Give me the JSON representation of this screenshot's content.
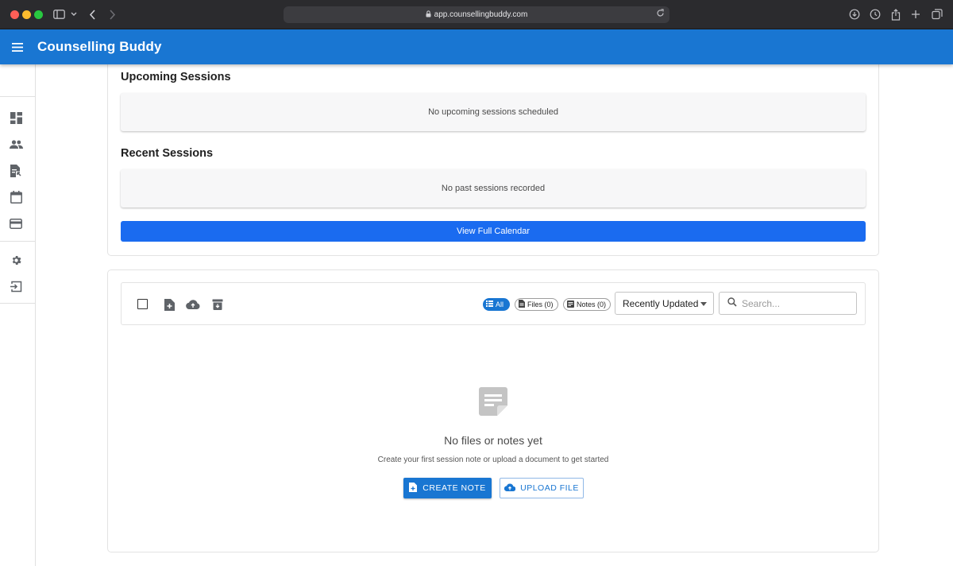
{
  "browser": {
    "url": "app.counsellingbuddy.com",
    "icons": [
      "sidebar-toggle-icon",
      "chevron-down-icon",
      "back-icon",
      "forward-icon",
      "reload-icon",
      "download-icon",
      "history-icon",
      "share-icon",
      "new-tab-icon",
      "tabs-overview-icon"
    ]
  },
  "appbar": {
    "title": "Counselling Buddy"
  },
  "sidebar": {
    "items": [
      {
        "icon": "dashboard-icon"
      },
      {
        "icon": "people-icon"
      },
      {
        "icon": "document-icon"
      },
      {
        "icon": "calendar-icon"
      },
      {
        "icon": "wallet-icon"
      },
      {
        "icon": "settings-icon"
      },
      {
        "icon": "logout-icon"
      }
    ]
  },
  "sessions": {
    "upcoming_title": "Upcoming Sessions",
    "upcoming_empty": "No upcoming sessions scheduled",
    "recent_title": "Recent Sessions",
    "recent_empty": "No past sessions recorded",
    "calendar_button": "View Full Calendar"
  },
  "files": {
    "filters": {
      "all": "All",
      "files": "Files (0)",
      "notes": "Notes (0)"
    },
    "sort": {
      "selected": "Recently Updated"
    },
    "search": {
      "placeholder": "Search..."
    },
    "empty": {
      "title": "No files or notes yet",
      "subtitle": "Create your first session note or upload a document to get started",
      "create_button": "CREATE NOTE",
      "upload_button": "UPLOAD FILE"
    }
  },
  "colors": {
    "primary": "#1976d2",
    "calendar_button": "#1a6bf0"
  }
}
